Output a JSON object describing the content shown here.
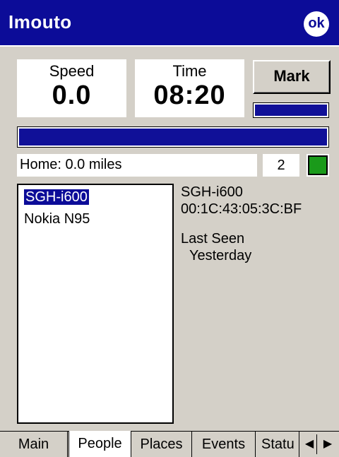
{
  "window": {
    "title": "Imouto",
    "ok_label": "ok"
  },
  "speed": {
    "label": "Speed",
    "value": "0.0"
  },
  "time": {
    "label": "Time",
    "value": "08:20"
  },
  "mark": {
    "label": "Mark",
    "progress": 1.0
  },
  "main_progress": 1.0,
  "home": {
    "text": "Home: 0.0 miles",
    "count": "2",
    "status_color": "#1a9a1a"
  },
  "devices": {
    "items": [
      "SGH-i600",
      "Nokia N95"
    ],
    "selected": "SGH-i600"
  },
  "details": {
    "name": "SGH-i600",
    "address": "00:1C:43:05:3C:BF",
    "last_seen_label": "Last Seen",
    "last_seen_value": "Yesterday"
  },
  "tabs": [
    "Main",
    "People",
    "Places",
    "Events",
    "Statu"
  ],
  "active_tab": "People",
  "colors": {
    "title_bar": "#0c0c98",
    "progress": "#101098",
    "background": "#d4d0c8"
  }
}
